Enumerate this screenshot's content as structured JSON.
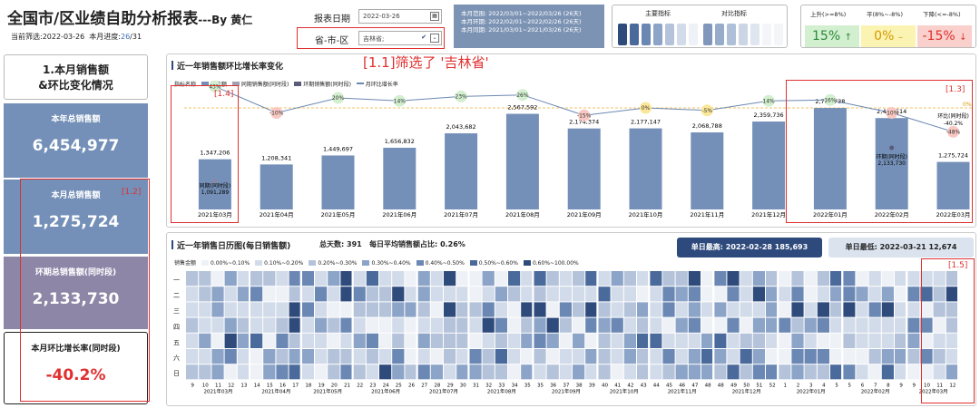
{
  "header": {
    "title": "全国市/区业绩自助分析报表",
    "author": "---By 黄仁",
    "filter_label": "当前筛选:2022-03-26",
    "progress_label": "本月进度:",
    "progress_value": "26",
    "progress_total": "/31"
  },
  "controls": {
    "date_label": "报表日期",
    "date_value": "2022-03-26",
    "region_label": "省-市-区",
    "region_value": "吉林省;"
  },
  "info": {
    "line1": "本月范围: 2022/03/01~2022/03/26 (26天)",
    "line2": "本月环期: 2022/02/01~2022/02/26 (26天)",
    "line3": "本月同期: 2021/03/01~2021/03/26 (26天)"
  },
  "legend": {
    "main": "主要指标",
    "compare": "对比指标",
    "colors": [
      "#2f4b7c",
      "#4a6a9c",
      "#6b88b4",
      "#8ca4c8",
      "#b4c3da",
      "#d2dbe9",
      "#eef1f6"
    ]
  },
  "trend": {
    "up_label": "上升(>=8%)",
    "flat_label": "平(8%~-8%)",
    "down_label": "下降(<=-8%)",
    "up_value": "15%",
    "flat_value": "0%",
    "down_value": "-15%"
  },
  "cards": {
    "c1_title": "1.本月销售额",
    "c1_sub": "&环比变化情况",
    "c2_title": "本年总销售额",
    "c2_value": "6,454,977",
    "c3_title": "本月总销售额",
    "c3_value": "1,275,724",
    "c4_title": "环期总销售额(同时段)",
    "c4_value": "2,133,730",
    "c5_title": "本月环比增长率(同时段)",
    "c5_value": "-40.2%"
  },
  "chart": {
    "title": "近一年销售额环比增长率变化",
    "annotation_filter": "[1.1]筛选了 '吉林省'",
    "legend_label": "指标名称",
    "legend_items": [
      "销售额",
      "同期销售额(同时段)",
      "环期销售额(同时段)",
      "月环比增长率"
    ],
    "anno_14": "[1.4]",
    "anno_13": "[1.3]",
    "same_period_label": "同期(同时段)",
    "same_period_value": "1,091,289",
    "prev_period_label": "环期(同时段)",
    "prev_period_value": "2,133,730",
    "mom_label": "环比(同时段)",
    "mom_value": "-40.2%",
    "ref_label": "0%"
  },
  "chart_data": {
    "type": "bar",
    "categories": [
      "2021年03月",
      "2021年04月",
      "2021年05月",
      "2021年06月",
      "2021年07月",
      "2021年08月",
      "2021年09月",
      "2021年10月",
      "2021年11月",
      "2021年12月",
      "2022年01月",
      "2022年02月",
      "2022年03月"
    ],
    "values": [
      1347206,
      1208341,
      1449697,
      1656832,
      2043682,
      2567592,
      2174374,
      2177147,
      2068788,
      2359736,
      2725738,
      2453514,
      1275724
    ],
    "value_labels": [
      "1,347,206",
      "1,208,341",
      "1,449,697",
      "1,656,832",
      "2,043,682",
      "2,567,592",
      "2,174,374",
      "2,177,147",
      "2,068,788",
      "2,359,736",
      "2,725,738",
      "2,453,514",
      "1,275,724"
    ],
    "growth": [
      43,
      -10,
      20,
      14,
      23,
      26,
      -15,
      0,
      -5,
      14,
      16,
      -10,
      -48
    ],
    "growth_labels": [
      "43%",
      "-10%",
      "20%",
      "14%",
      "23%",
      "26%",
      "-15%",
      "0%",
      "-5%",
      "14%",
      "16%",
      "-10%",
      "-48%"
    ]
  },
  "heatmap": {
    "title": "近一年销售日历图(每日销售额)",
    "days_label": "总天数:",
    "days_value": "391",
    "avg_label": "每日平均销售额占比:",
    "avg_value": "0.26%",
    "max_label": "单日最高:",
    "max_value": "2022-02-28 185,693",
    "min_label": "单日最低:",
    "min_value": "2022-03-21 12,674",
    "legend_label": "销售金额",
    "legend": [
      "0.00%~0.10%",
      "0.10%~0.20%",
      "0.20%~0.30%",
      "0.30%~0.40%",
      "0.40%~0.50%",
      "0.50%~0.60%",
      "0.60%~100.00%"
    ],
    "weekdays": [
      "一",
      "二",
      "三",
      "四",
      "五",
      "六",
      "日"
    ],
    "months": [
      "2021年03月",
      "2021年04月",
      "2021年05月",
      "2021年06月",
      "2021年07月",
      "2021年08月",
      "2021年09月",
      "2021年10月",
      "2021年11月",
      "2021年12月",
      "2022年01月",
      "2022年02月",
      "2022年03月"
    ],
    "weeks": [
      "9",
      "10",
      "11",
      "12",
      "13",
      "14",
      "15",
      "16",
      "17",
      "18",
      "19",
      "20",
      "21",
      "22",
      "23",
      "24",
      "25",
      "26",
      "27",
      "28",
      "29",
      "30",
      "31",
      "32",
      "33",
      "34",
      "35",
      "35",
      "36",
      "37",
      "38",
      "39",
      "40",
      "41",
      "42",
      "43",
      "44",
      "45",
      "46",
      "47",
      "48",
      "48",
      "49",
      "50",
      "51",
      "52",
      "1",
      "2",
      "3",
      "4",
      "5",
      "5",
      "6",
      "7",
      "8",
      "9",
      "9",
      "10",
      "11",
      "12"
    ],
    "anno_15": "[1.5]"
  },
  "annotations": {
    "a12": "[1.2]"
  }
}
